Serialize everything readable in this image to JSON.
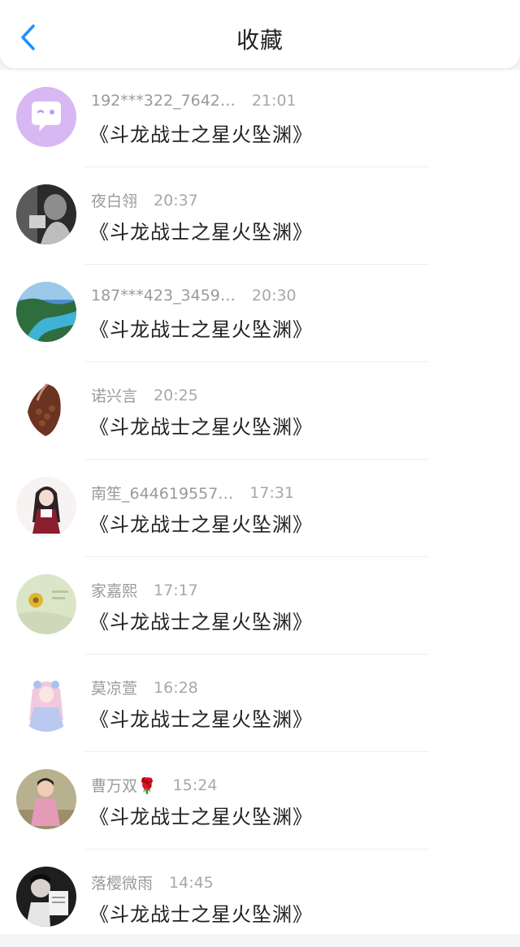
{
  "header": {
    "title": "收藏",
    "back_icon": "chevron-left-icon",
    "accent_color": "#1e90ff"
  },
  "items": [
    {
      "name": "192***322_7642…",
      "time": "21:01",
      "book": "《斗龙战士之星火坠渊》",
      "avatar": "chat-bubble-avatar"
    },
    {
      "name": "夜白翎",
      "time": "20:37",
      "book": "《斗龙战士之星火坠渊》",
      "avatar": "portrait-photo-avatar"
    },
    {
      "name": "187***423_3459…",
      "time": "20:30",
      "book": "《斗龙战士之星火坠渊》",
      "avatar": "landscape-river-avatar"
    },
    {
      "name": "诺兴言",
      "time": "20:25",
      "book": "《斗龙战士之星火坠渊》",
      "avatar": "coffee-beans-avatar"
    },
    {
      "name": "南笙_644619557…",
      "time": "17:31",
      "book": "《斗龙战士之星火坠渊》",
      "avatar": "anime-girl-avatar"
    },
    {
      "name": "家嘉熙",
      "time": "17:17",
      "book": "《斗龙战士之星火坠渊》",
      "avatar": "flower-avatar"
    },
    {
      "name": "莫凉萱",
      "time": "16:28",
      "book": "《斗龙战士之星火坠渊》",
      "avatar": "anime-pink-girl-avatar"
    },
    {
      "name": "曹万双🌹",
      "time": "15:24",
      "book": "《斗龙战士之星火坠渊》",
      "avatar": "child-photo-avatar"
    },
    {
      "name": "落樱微雨",
      "time": "14:45",
      "book": "《斗龙战士之星火坠渊》",
      "avatar": "reading-photo-avatar"
    }
  ]
}
